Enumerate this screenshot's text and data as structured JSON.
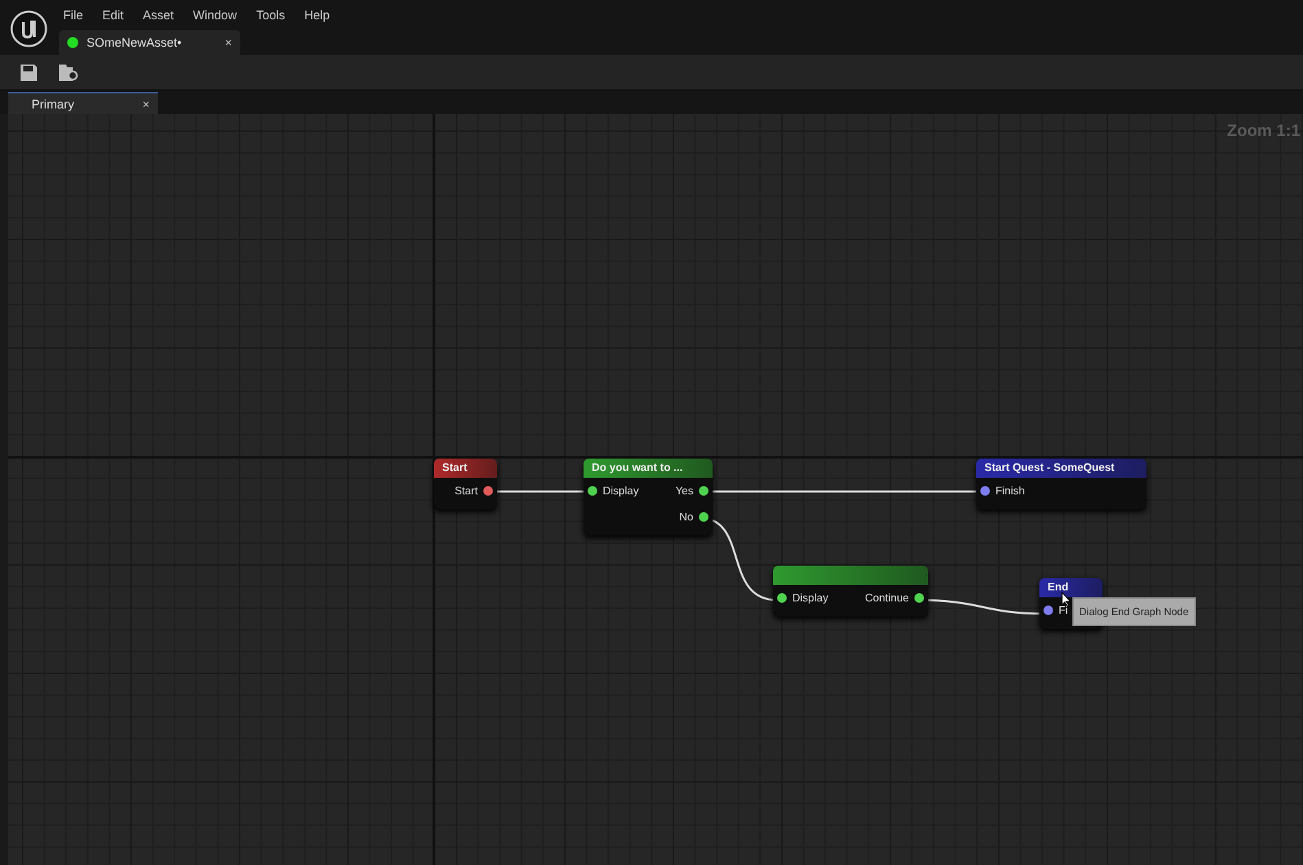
{
  "menu": [
    "File",
    "Edit",
    "Asset",
    "Window",
    "Tools",
    "Help"
  ],
  "document_tab": {
    "title": "SOmeNewAsset•",
    "close": "×",
    "modified": true
  },
  "graph_tab": {
    "title": "Primary",
    "close": "×"
  },
  "zoom_label": "Zoom 1:1",
  "nodes": [
    {
      "title": "Start",
      "color": "#b02a2a",
      "pins": [
        {
          "out": "Start"
        }
      ]
    },
    {
      "title": "Do you want to ...",
      "color": "#2f9a2f",
      "pins": [
        {
          "in": "Display",
          "out": "Yes"
        },
        {
          "out": "No"
        }
      ]
    },
    {
      "title": "Start Quest - SomeQuest",
      "color": "#2a2aa8",
      "pins": [
        {
          "in": "Finish"
        }
      ]
    },
    {
      "color": "#2f9a2f",
      "pins": [
        {
          "in": "Display",
          "out": "Continue"
        }
      ]
    },
    {
      "title": "End",
      "color": "#2a2aa8",
      "pins": [
        {
          "in": "Fi"
        }
      ]
    }
  ],
  "tooltip": "Dialog End Graph Node"
}
